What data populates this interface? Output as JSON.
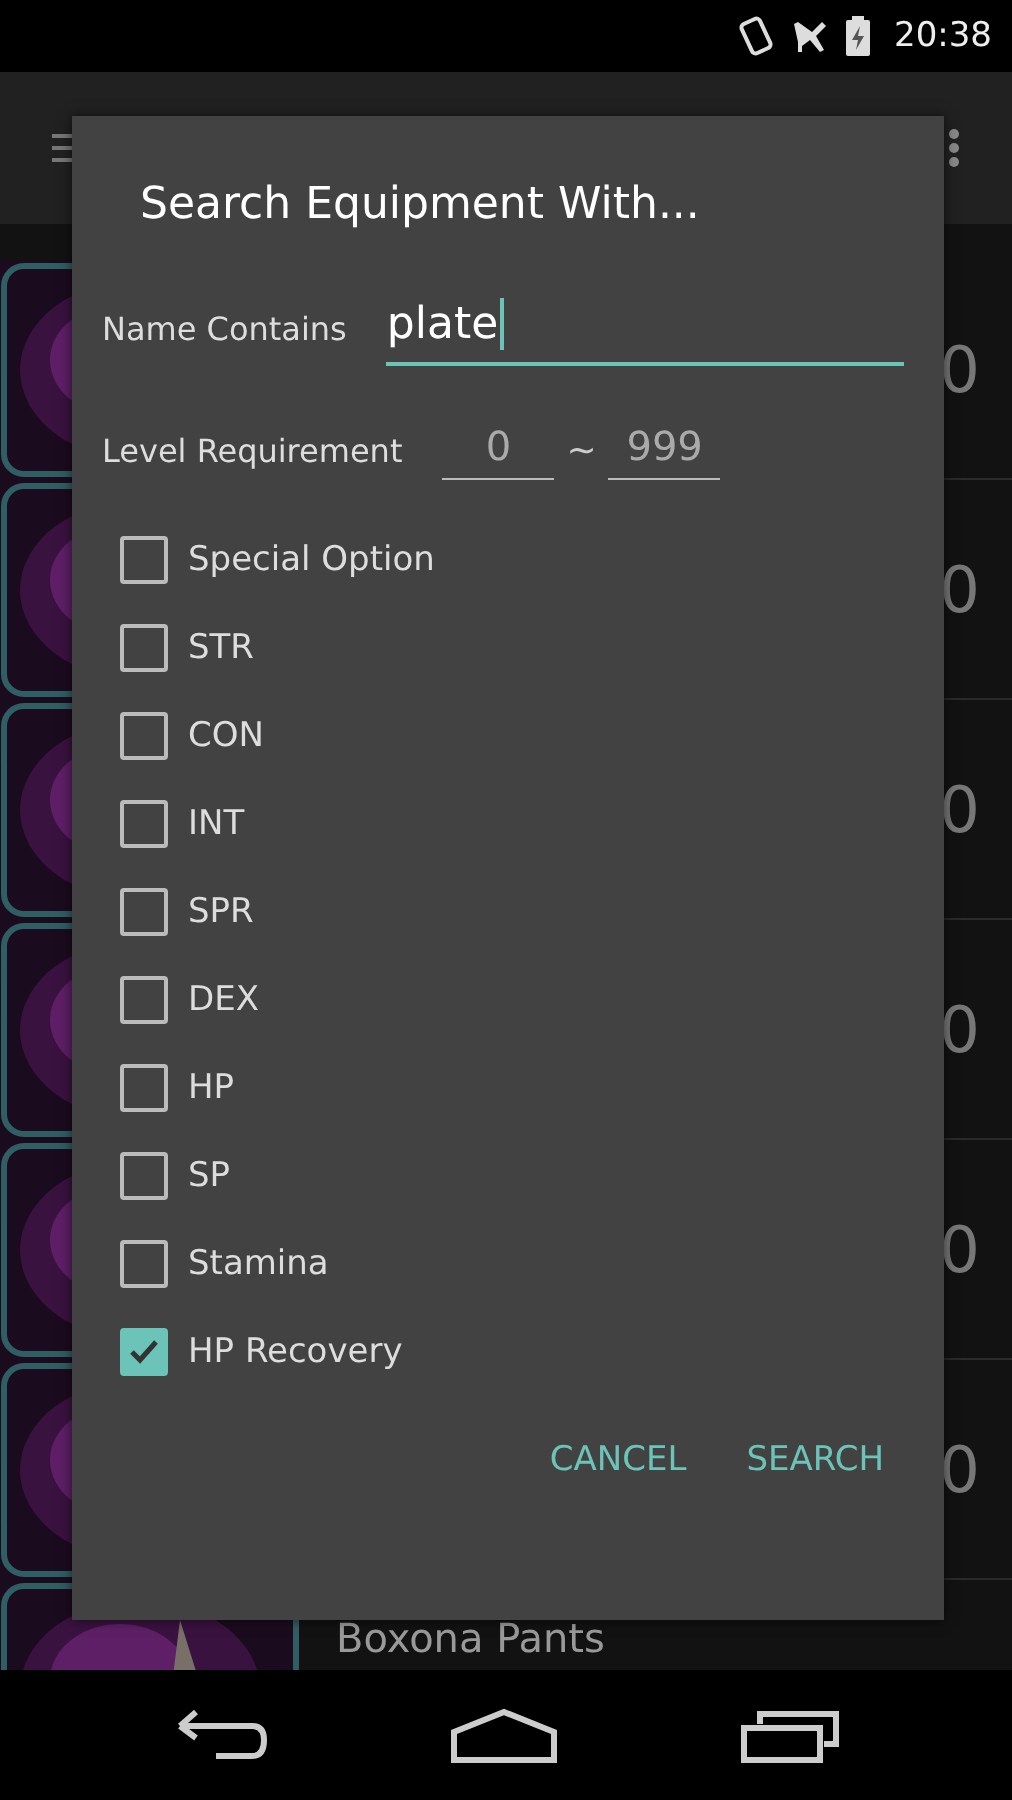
{
  "status_bar": {
    "time": "20:38"
  },
  "list": {
    "rows": [
      {
        "value": "0"
      },
      {
        "value": "0"
      },
      {
        "value": "0"
      },
      {
        "value": "0"
      },
      {
        "value": "0"
      },
      {
        "value": "0"
      },
      {
        "name": "Boxona Pants"
      }
    ]
  },
  "dialog": {
    "title": "Search Equipment With...",
    "name_field": {
      "label": "Name Contains",
      "value": "plate"
    },
    "level_field": {
      "label": "Level Requirement",
      "min": "0",
      "separator": "~",
      "max": "999"
    },
    "options": [
      {
        "label": "Special Option",
        "checked": false
      },
      {
        "label": "STR",
        "checked": false
      },
      {
        "label": "CON",
        "checked": false
      },
      {
        "label": "INT",
        "checked": false
      },
      {
        "label": "SPR",
        "checked": false
      },
      {
        "label": "DEX",
        "checked": false
      },
      {
        "label": "HP",
        "checked": false
      },
      {
        "label": "SP",
        "checked": false
      },
      {
        "label": "Stamina",
        "checked": false
      },
      {
        "label": "HP Recovery",
        "checked": true
      }
    ],
    "buttons": [
      "CANCEL",
      "SEARCH"
    ]
  }
}
